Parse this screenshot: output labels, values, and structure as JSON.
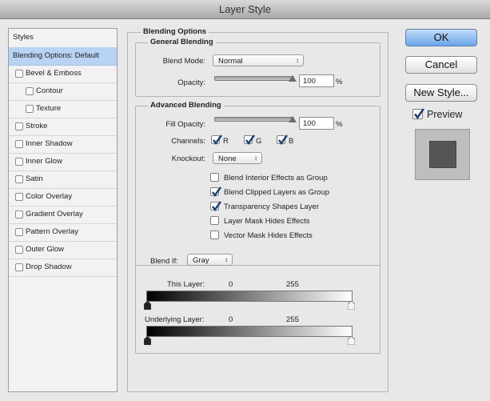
{
  "window": {
    "title": "Layer Style"
  },
  "left_panel": {
    "header": "Styles",
    "items": [
      {
        "label": "Blending Options: Default",
        "selected": true,
        "checkbox": false
      },
      {
        "label": "Bevel & Emboss",
        "checkbox": true,
        "checked": false
      },
      {
        "label": "Contour",
        "checkbox": true,
        "checked": false,
        "indent": true
      },
      {
        "label": "Texture",
        "checkbox": true,
        "checked": false,
        "indent": true
      },
      {
        "label": "Stroke",
        "checkbox": true,
        "checked": false
      },
      {
        "label": "Inner Shadow",
        "checkbox": true,
        "checked": false
      },
      {
        "label": "Inner Glow",
        "checkbox": true,
        "checked": false
      },
      {
        "label": "Satin",
        "checkbox": true,
        "checked": false
      },
      {
        "label": "Color Overlay",
        "checkbox": true,
        "checked": false
      },
      {
        "label": "Gradient Overlay",
        "checkbox": true,
        "checked": false
      },
      {
        "label": "Pattern Overlay",
        "checkbox": true,
        "checked": false
      },
      {
        "label": "Outer Glow",
        "checkbox": true,
        "checked": false
      },
      {
        "label": "Drop Shadow",
        "checkbox": true,
        "checked": false
      }
    ]
  },
  "blending_options": {
    "title": "Blending Options",
    "general": {
      "title": "General Blending",
      "blend_mode_label": "Blend Mode:",
      "blend_mode_value": "Normal",
      "opacity_label": "Opacity:",
      "opacity_value": "100",
      "opacity_unit": "%",
      "opacity_level": 1.0
    },
    "advanced": {
      "title": "Advanced Blending",
      "fill_opacity_label": "Fill Opacity:",
      "fill_opacity_value": "100",
      "fill_opacity_unit": "%",
      "fill_opacity_level": 1.0,
      "channels_label": "Channels:",
      "channels": [
        {
          "label": "R",
          "checked": true
        },
        {
          "label": "G",
          "checked": true
        },
        {
          "label": "B",
          "checked": true
        }
      ],
      "knockout_label": "Knockout:",
      "knockout_value": "None",
      "options": [
        {
          "label": "Blend Interior Effects as Group",
          "checked": false
        },
        {
          "label": "Blend Clipped Layers as Group",
          "checked": true
        },
        {
          "label": "Transparency Shapes Layer",
          "checked": true
        },
        {
          "label": "Layer Mask Hides Effects",
          "checked": false
        },
        {
          "label": "Vector Mask Hides Effects",
          "checked": false
        }
      ]
    },
    "blend_if": {
      "label": "Blend If:",
      "value": "Gray",
      "this_layer_label": "This Layer:",
      "this_layer_low": "0",
      "this_layer_high": "255",
      "underlying_label": "Underlying Layer:",
      "underlying_low": "0",
      "underlying_high": "255"
    }
  },
  "buttons": {
    "ok": "OK",
    "cancel": "Cancel",
    "new_style": "New Style...",
    "preview_label": "Preview",
    "preview_checked": true
  },
  "colors": {
    "selected_row": "#b8d3f3",
    "primary_button": "#6aa5ea",
    "check_color": "#1d3f72"
  },
  "icons": [
    "chevron-updown-icon",
    "checkmark-icon",
    "slider-triangle-icon",
    "gradient-stop-icon"
  ]
}
